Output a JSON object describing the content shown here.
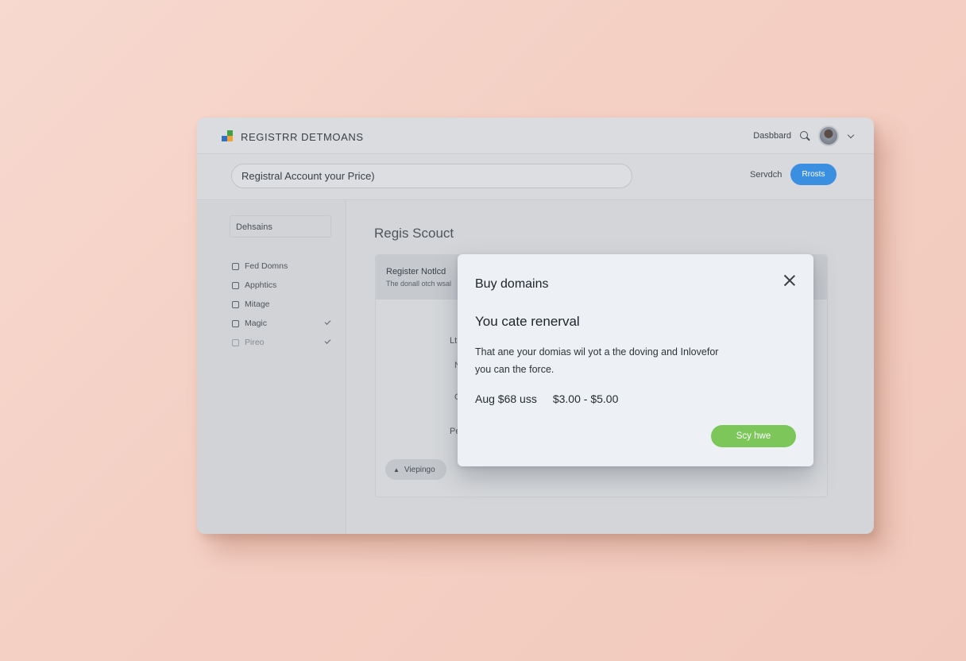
{
  "header": {
    "brand": "REGISTRR DETMOANS",
    "nav_dashboard": "Dasbbard"
  },
  "subbar": {
    "account_value": "Registral Account your Price)",
    "search_label": "Servdch",
    "primary_button": "Rrosts"
  },
  "sidebar": {
    "heading": "Dehsains",
    "items": [
      {
        "label": "Fed Domns",
        "icon": "grid-icon",
        "check": false
      },
      {
        "label": "Apphtics",
        "icon": "app-icon",
        "check": false
      },
      {
        "label": "Mitage",
        "icon": "wand-icon",
        "check": false
      },
      {
        "label": "Magic",
        "icon": "bag-icon",
        "check": true
      },
      {
        "label": "Pireo",
        "icon": "phone-icon",
        "check": true
      }
    ]
  },
  "main": {
    "title": "Regis Scouct",
    "card_title": "Register Notlcd",
    "card_subtitle": "The donall otch wsal",
    "fragments": [
      "Lt",
      "N",
      "C",
      "Pe"
    ],
    "chip_label": "Viepingo"
  },
  "modal": {
    "title": "Buy domains",
    "heading": "You cate renerval",
    "description_line1": "That ane your domias wil yot a the doving and Inlovefor",
    "description_line2": "you can the force.",
    "price_avg": "Aug $68 uss",
    "price_range": "$3.00 - $5.00",
    "cta_label": "Scy hwe"
  },
  "colors": {
    "background": "#f5d2c6",
    "primary": "#3b8fe0",
    "cta": "#7cc65a"
  }
}
